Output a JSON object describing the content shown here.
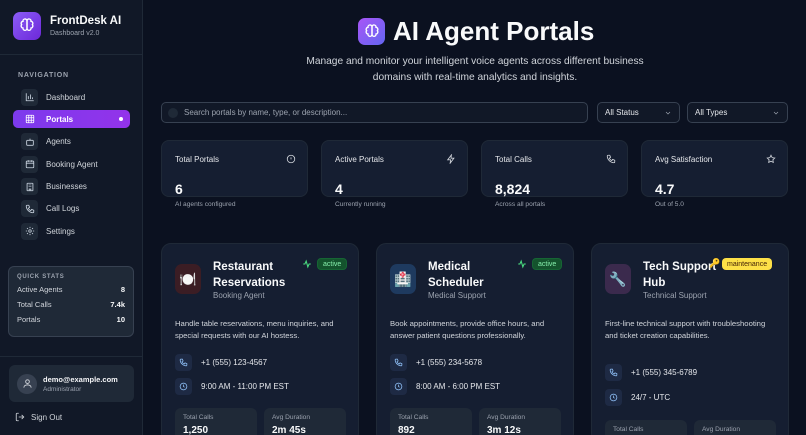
{
  "brand": {
    "name": "FrontDesk AI",
    "subtitle": "Dashboard v2.0"
  },
  "nav": {
    "heading": "NAVIGATION",
    "items": [
      {
        "label": "Dashboard",
        "icon": "bar-chart-icon",
        "active": false
      },
      {
        "label": "Portals",
        "icon": "grid-icon",
        "active": true
      },
      {
        "label": "Agents",
        "icon": "bot-icon",
        "active": false
      },
      {
        "label": "Booking Agent",
        "icon": "calendar-icon",
        "active": false
      },
      {
        "label": "Businesses",
        "icon": "building-icon",
        "active": false
      },
      {
        "label": "Call Logs",
        "icon": "phone-icon",
        "active": false
      },
      {
        "label": "Settings",
        "icon": "gear-icon",
        "active": false
      }
    ]
  },
  "quick_stats": {
    "heading": "QUICK STATS",
    "rows": [
      {
        "label": "Active Agents",
        "value": "8"
      },
      {
        "label": "Total Calls",
        "value": "7.4k"
      },
      {
        "label": "Portals",
        "value": "10"
      }
    ]
  },
  "user": {
    "email": "demo@example.com",
    "role": "Administrator",
    "signout": "Sign Out"
  },
  "header": {
    "title": "AI Agent Portals",
    "subtitle": "Manage and monitor your intelligent voice agents across different business domains with real-time analytics and insights."
  },
  "filters": {
    "search_placeholder": "Search portals by name, type, or description...",
    "status": "All Status",
    "types": "All Types"
  },
  "stats": [
    {
      "label": "Total Portals",
      "value": "6",
      "note": "AI agents configured",
      "icon": "info-circle-icon"
    },
    {
      "label": "Active Portals",
      "value": "4",
      "note": "Currently running",
      "icon": "lightning-icon"
    },
    {
      "label": "Total Calls",
      "value": "8,824",
      "note": "Across all portals",
      "icon": "phone-icon"
    },
    {
      "label": "Avg Satisfaction",
      "value": "4.7",
      "note": "Out of 5.0",
      "icon": "star-icon"
    }
  ],
  "portals": [
    {
      "title_line1": "Restaurant",
      "title_line2": "Reservations",
      "type": "Booking Agent",
      "status": "active",
      "emoji": "🍽️",
      "icon": "plate-icon",
      "description": "Handle table reservations, menu inquiries, and special requests with our AI hostess.",
      "phone": "+1 (555) 123-4567",
      "hours": "9:00 AM - 11:00 PM EST",
      "calls_label": "Total Calls",
      "calls": "1,250",
      "duration_label": "Avg Duration",
      "duration": "2m 45s"
    },
    {
      "title_line1": "Medical",
      "title_line2": "Scheduler",
      "type": "Medical Support",
      "status": "active",
      "emoji": "🏥",
      "icon": "hospital-icon",
      "description": "Book appointments, provide office hours, and answer patient questions professionally.",
      "phone": "+1 (555) 234-5678",
      "hours": "8:00 AM - 6:00 PM EST",
      "calls_label": "Total Calls",
      "calls": "892",
      "duration_label": "Avg Duration",
      "duration": "3m 12s"
    },
    {
      "title_line1": "Tech Support",
      "title_line2": "Hub",
      "type": "Technical Support",
      "status": "maintenance",
      "emoji": "🔧",
      "icon": "wrench-icon",
      "badge_emoji": "🔑",
      "description": "First-line technical support with troubleshooting and ticket creation capabilities.",
      "phone": "+1 (555) 345-6789",
      "hours": "24/7 - UTC",
      "calls_label": "Total Calls",
      "calls": "",
      "duration_label": "Avg Duration",
      "duration": ""
    }
  ],
  "colors": {
    "accent": "#7c3aed",
    "active": "#86efac",
    "maintenance": "#fde047"
  }
}
